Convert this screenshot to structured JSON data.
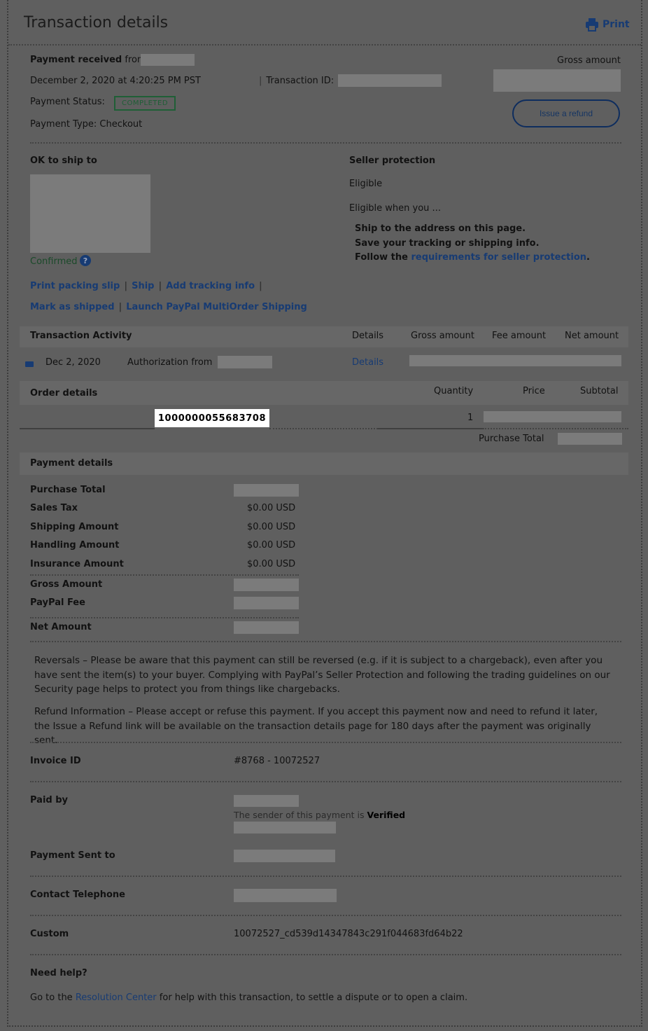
{
  "header": {
    "title": "Transaction details",
    "print_label": "Print"
  },
  "summary": {
    "received_label": "Payment received",
    "from_label": "from",
    "date": "December 2, 2020 at 4:20:25 PM PST",
    "transaction_id_label": "Transaction ID:",
    "status_label": "Payment Status:",
    "status_value": "COMPLETED",
    "type_text": "Payment Type: Checkout",
    "gross_amount_label": "Gross amount",
    "refund_button": "Issue a refund"
  },
  "shipping": {
    "ok_to_ship_label": "OK to ship to",
    "confirmed_label": "Confirmed",
    "help_icon_glyph": "?",
    "actions": [
      "Print packing slip",
      "Ship",
      "Add tracking info",
      "Mark as shipped",
      "Launch PayPal MultiOrder Shipping"
    ]
  },
  "seller_protection": {
    "title": "Seller protection",
    "status": "Eligible",
    "intro": "Eligible when you ...",
    "item1": "Ship to the address on this page.",
    "item2": "Save your tracking or shipping info.",
    "item3_prefix": "Follow the",
    "item3_link": "requirements for seller protection",
    "item3_suffix": "."
  },
  "activity": {
    "title": "Transaction Activity",
    "columns": [
      "Details",
      "Gross amount",
      "Fee amount",
      "Net amount"
    ],
    "row": {
      "date": "Dec 2, 2020",
      "description": "Authorization from",
      "details_link": "Details"
    }
  },
  "order": {
    "title": "Order details",
    "columns": [
      "Quantity",
      "Price",
      "Subtotal"
    ],
    "item_number": "1000000055683708",
    "quantity": "1",
    "purchase_total_label": "Purchase Total"
  },
  "payment_details": {
    "title": "Payment details",
    "rows": [
      {
        "label": "Purchase Total",
        "value": ""
      },
      {
        "label": "Sales Tax",
        "value": "$0.00 USD"
      },
      {
        "label": "Shipping Amount",
        "value": "$0.00 USD"
      },
      {
        "label": "Handling Amount",
        "value": "$0.00 USD"
      },
      {
        "label": "Insurance Amount",
        "value": "$0.00 USD"
      },
      {
        "label": "Gross Amount",
        "value": ""
      },
      {
        "label": "PayPal Fee",
        "value": ""
      },
      {
        "label": "Net Amount",
        "value": ""
      }
    ]
  },
  "notices": {
    "reversals": "Reversals – Please be aware that this payment can still be reversed (e.g. if it is subject to a chargeback), even after you have sent the item(s) to your buyer. Complying with PayPal’s Seller Protection and following the trading guidelines on our Security page helps to protect you from things like chargebacks.",
    "refund": "Refund Information – Please accept or refuse this payment. If you accept this payment now and need to refund it later, the Issue a Refund link will be available on the transaction details page for 180 days after the payment was originally sent."
  },
  "info": {
    "invoice_label": "Invoice ID",
    "invoice_value": "#8768 - 10072527",
    "paid_by_label": "Paid by",
    "verified_prefix": "The sender of this payment is",
    "verified_word": "Verified",
    "sent_to_label": "Payment Sent to",
    "telephone_label": "Contact Telephone",
    "custom_label": "Custom",
    "custom_value": "10072527_cd539d14347843c291f044683fd64b22"
  },
  "help": {
    "title": "Need help?",
    "prefix": "Go to the",
    "link": "Resolution Center",
    "suffix": "for help with this transaction, to settle a dispute or to open a claim."
  }
}
